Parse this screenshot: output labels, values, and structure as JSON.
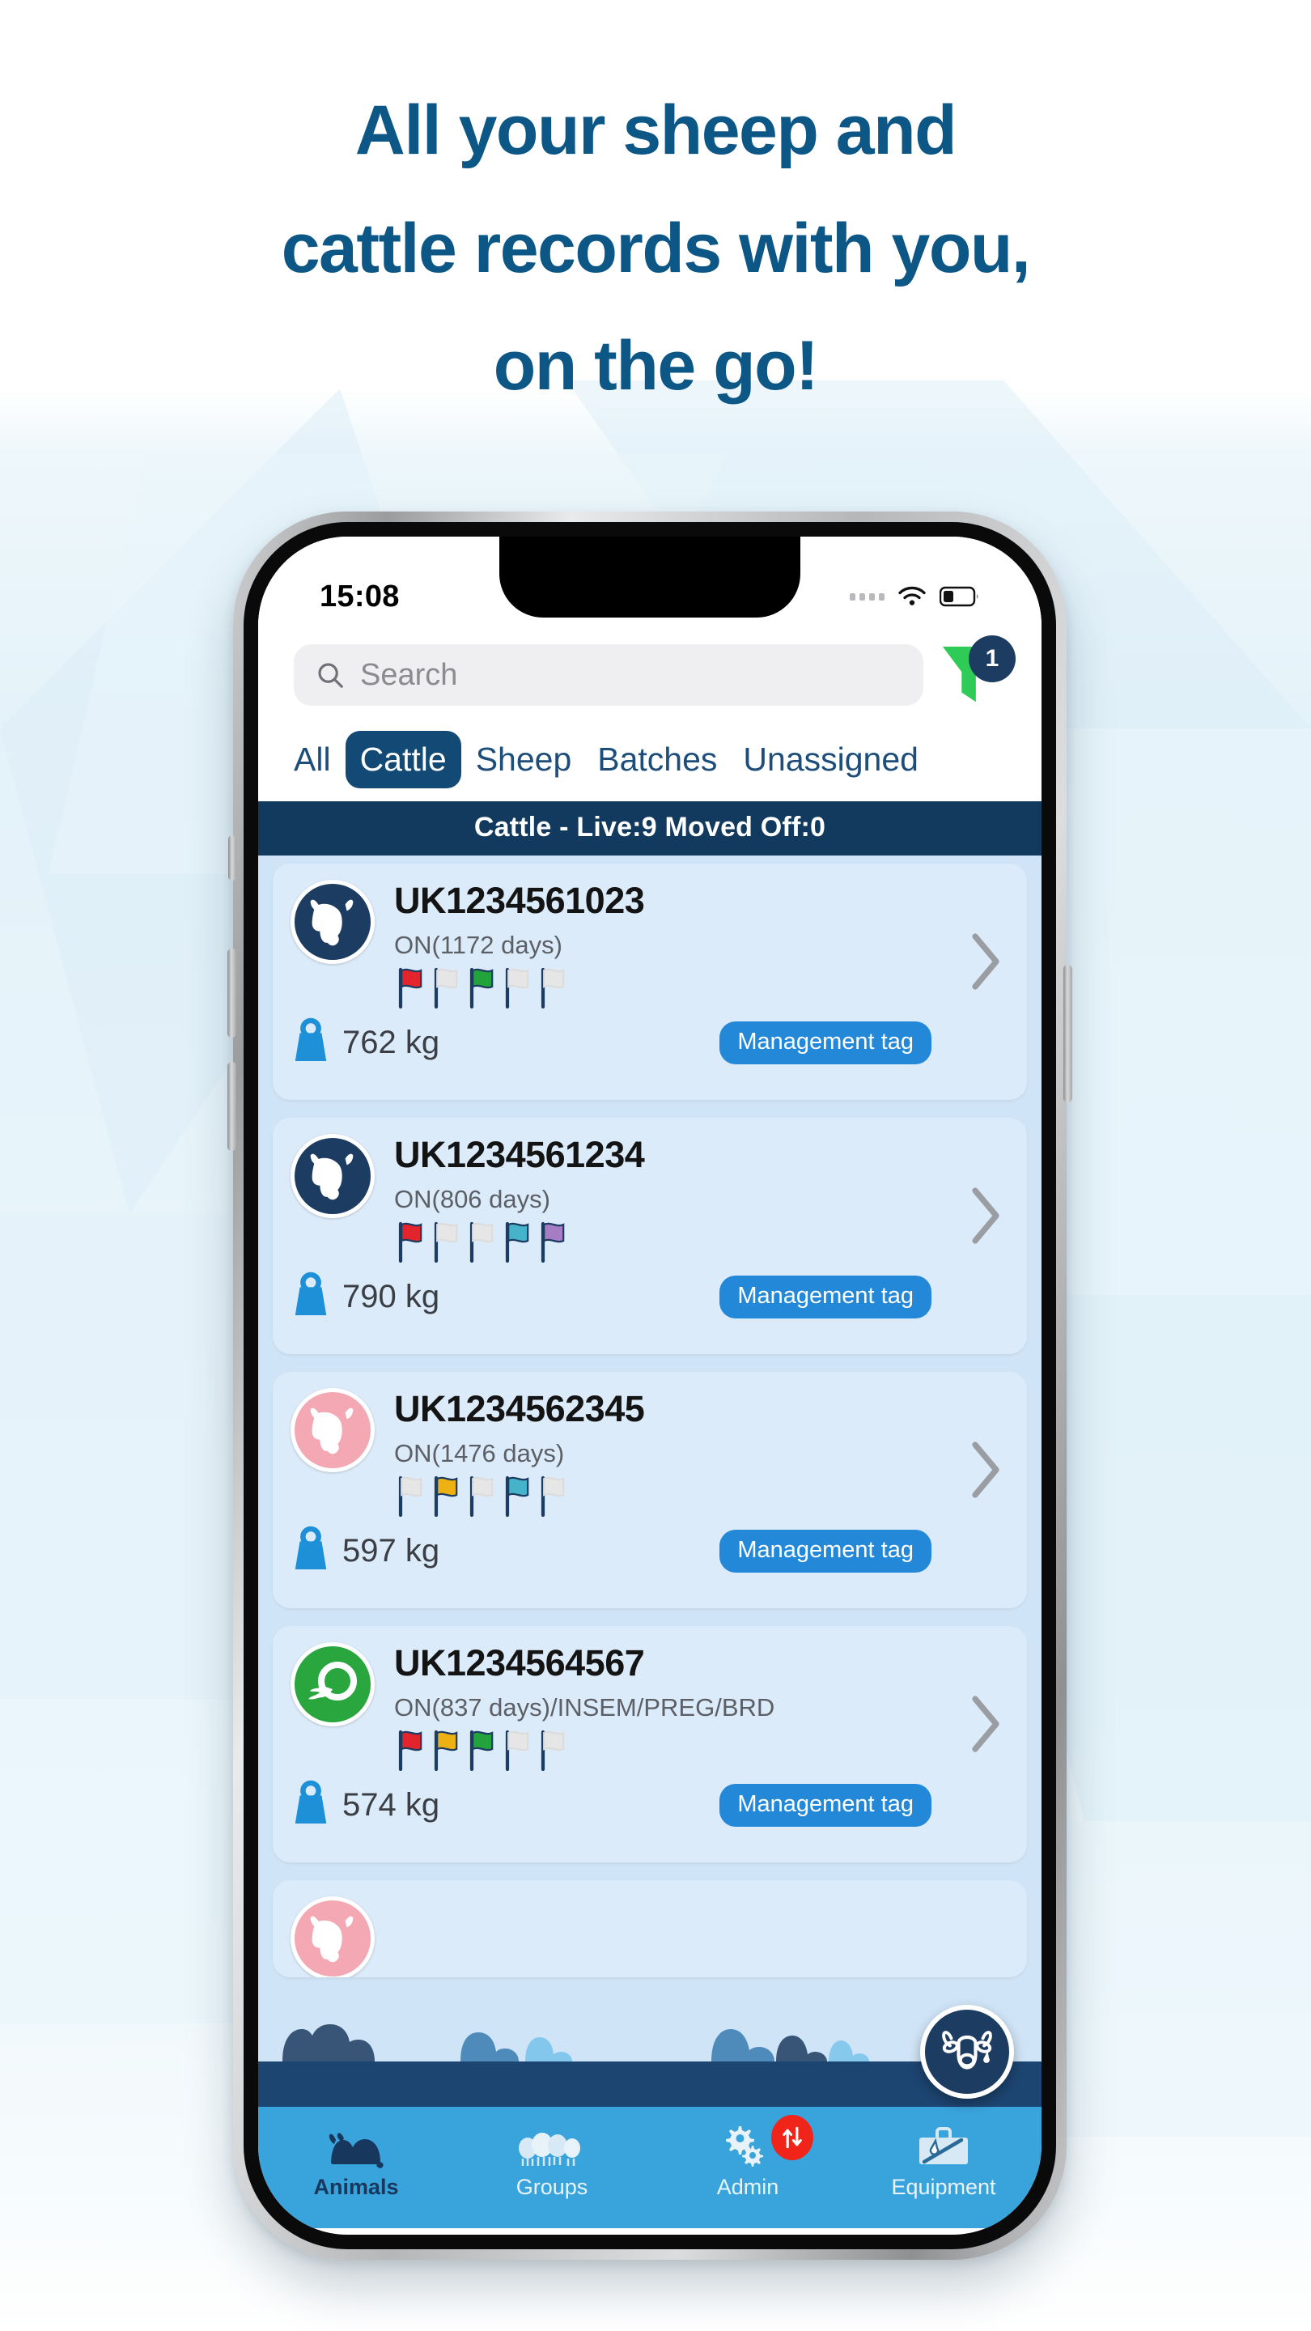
{
  "promo": {
    "headline_lines": [
      "All your sheep and",
      "cattle records with you,",
      "on the go!"
    ],
    "headline_color": "#0d5786"
  },
  "phone": {
    "status_bar": {
      "time": "15:08",
      "signal_icon": "signal-dots-icon",
      "wifi_icon": "wifi-icon",
      "battery_icon": "battery-low-icon"
    },
    "search": {
      "icon": "search-icon",
      "placeholder": "Search",
      "value": ""
    },
    "filter": {
      "icon": "filter-funnel-icon",
      "badge_count": "1",
      "color": "#2ecc57",
      "badge_color": "#1d3c61"
    },
    "tabs": [
      {
        "label": "All",
        "active": false
      },
      {
        "label": "Cattle",
        "active": true
      },
      {
        "label": "Sheep",
        "active": false
      },
      {
        "label": "Batches",
        "active": false
      },
      {
        "label": "Unassigned",
        "active": false
      }
    ],
    "section_header": "Cattle - Live:9 Moved Off:0",
    "animals": [
      {
        "id": "UK1234561023",
        "status": "ON(1172 days)",
        "weight": "762 kg",
        "tag_label": "Management tag",
        "avatar_style": "navy",
        "avatar_icon": "cow-head-icon",
        "flags": [
          "#e4242c",
          "#e6e6e6",
          "#22a33c",
          "#e6e6e6",
          "#e6e6e6"
        ]
      },
      {
        "id": "UK1234561234",
        "status": "ON(806 days)",
        "weight": "790 kg",
        "tag_label": "Management tag",
        "avatar_style": "navy",
        "avatar_icon": "cow-head-icon",
        "flags": [
          "#e4242c",
          "#e6e6e6",
          "#e6e6e6",
          "#45b3c9",
          "#a67cc4"
        ]
      },
      {
        "id": "UK1234562345",
        "status": "ON(1476 days)",
        "weight": "597 kg",
        "tag_label": "Management tag",
        "avatar_style": "pink",
        "avatar_icon": "cow-head-icon",
        "flags": [
          "#e6e6e6",
          "#eeb114",
          "#e6e6e6",
          "#45b3c9",
          "#e6e6e6"
        ]
      },
      {
        "id": "UK1234564567",
        "status": "ON(837 days)/INSEM/PREG/BRD",
        "weight": "574 kg",
        "tag_label": "Management tag",
        "avatar_style": "green",
        "avatar_icon": "insemination-icon",
        "flags": [
          "#e4242c",
          "#eeb114",
          "#22a33c",
          "#e6e6e6",
          "#e6e6e6"
        ]
      }
    ],
    "fab": {
      "icon": "cow-face-tag-icon",
      "color": "#1d3c61"
    },
    "bottom_nav": [
      {
        "label": "Animals",
        "icon": "cattle-icon",
        "active": true,
        "badge": ""
      },
      {
        "label": "Groups",
        "icon": "sheep-group-icon",
        "active": false,
        "badge": ""
      },
      {
        "label": "Admin",
        "icon": "gears-icon",
        "active": false,
        "badge": "sync-arrows-icon"
      },
      {
        "label": "Equipment",
        "icon": "toolbox-icon",
        "active": false,
        "badge": ""
      }
    ]
  }
}
